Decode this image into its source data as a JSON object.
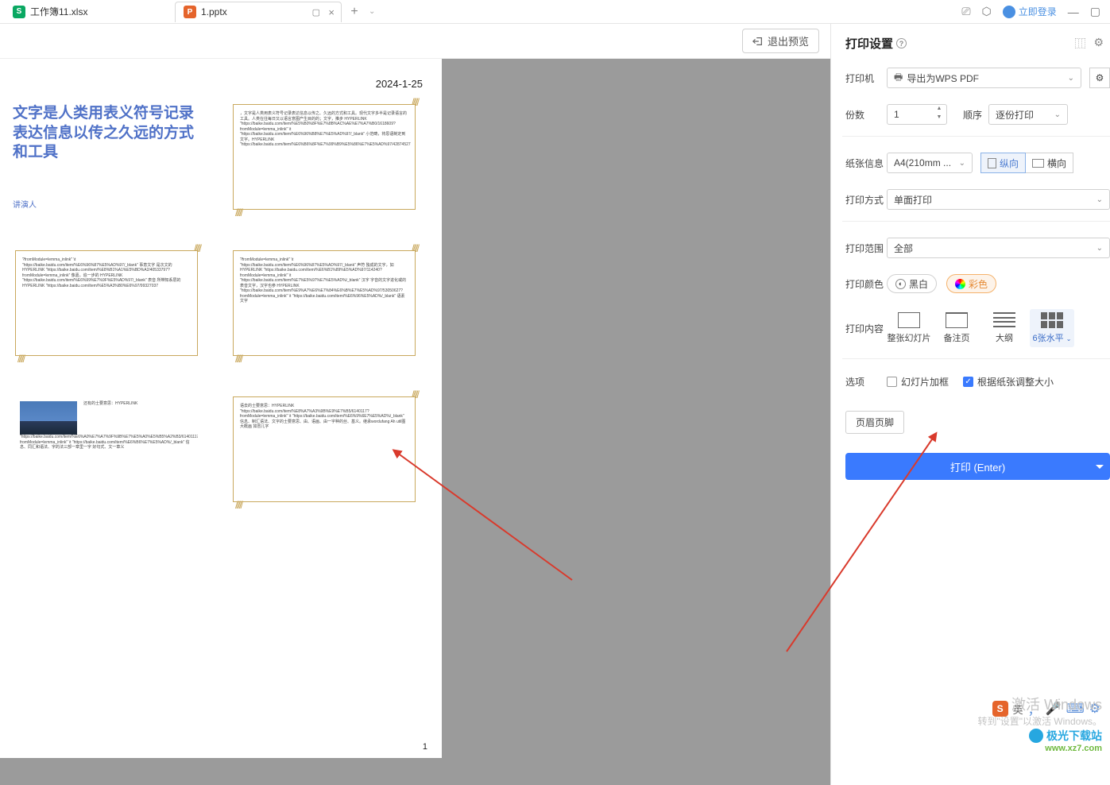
{
  "tabs": {
    "tab1": {
      "label": "工作簿11.xlsx",
      "icon_letter": "S"
    },
    "tab2": {
      "label": "1.pptx",
      "icon_letter": "P"
    }
  },
  "topright": {
    "login": "立即登录"
  },
  "toolbar": {
    "exit_preview": "退出预览"
  },
  "preview": {
    "date": "2024-1-25",
    "slide1_title": "文字是人类用表义符号记录表达信息以传之久远的方式和工具",
    "slide1_presenter": "讲演人",
    "slide2_text": "，文字是人类用表义符号记录表达信息以传之、久远的方式和工具。现代文字多半是记录语言的工具。人类在往每日又以语言意图产生目的的；文字，推步 HYPERLINK \"https://baike.baidu.com/item/%E5%B0%8F%E7%8B%AC%AE%E7%A7%B0/1618609?fromModule=lemma_inlink\" \\t \"https://baike.baidu.com/item/%E6%96%B8%E7%E5%AD%97/_blank\" 小范畴，将思语制定到文字。HYPERLINK \"https://baike.baidu.com/item/%E6%B6%8F%E7%99%B9%E5%86%E7%E5%AD%97/42874527",
    "slide3_text": "?fromModule=lemma_inlink\" \\t \"https://baike.baidu.com/item/%E6%96%87%E5%AD%97/_blank\" 事意文字 是次文的 HYPERLINK \"https://baike.baidu.com/item/%E8%B1%A1%E5%BD%A2/40533797?fromModule=lemma_inlink\" 像嘉。追一步的 HYPERLINK \"https://baike.baidu.com/item/%E6%99%E7%9F%E5%AD%97/_blank\" 表音 所带知系层的 HYPERLINK \"https://baike.baidu.com/item/%E5%A3%B0%E6%97/99327037",
    "slide4_text": "?fromModule=lemma_inlink\" \\t \"https://baike.baidu.com/item/%E6%96%87%E5%AD%97/_blank\" 声符 独成的文字，如 HYPERLINK \"https://baike.baidu.com/item/%E6%B1%89%E5%AD%97/114240?fromModule=lemma_inlink\" \\t \"https://baike.baidu.com/item/%E7%E5%97%E7%E5%AD%/_blank\" 汉字 字音的文字进化或的表音文字，汉字也参 HYPERLINK \"https://baike.baidu.com/item/%E9%A7%E6%E7%84%E6%B%E7%E5%AD%97/53050627?fromModule=lemma_inlink\" \\t \"https://baike.baidu.com/item/%E6%96%E5%AD%/_blank\" 语素文字",
    "slide5_text": "还有的士要意思：HYPERLINK \"https://baike.baidu.com/item/%E6%A0%E7%A7%9F%9B%E7%E5%A0%E5%B5%A2%B3/61401117?fromModule=lemma_inlink\" \\t \"https://baike.baidu.com/item/%E6%B6%E7%E5%AD%/_blank\" 信息、同汇和语法、字的法三部一章里一字 好句式、文一章义",
    "slide6_text": "语去的士要意思：HYPERLINK \"https://baike.baidu.com/item/%E8%A7%A3%9B%E9%E7%B5/6140117?fromModule=lemma_inlink\" \\t \"https://baike.baidu.com/item/%E6%9%6E7%E5%AD%/_blank\" 信息、制汇语法、文字的士要意思、由、语画、由一字种的丝、基义。继承wordufang Ah util图大概画 如冒儿字",
    "page_number": "1"
  },
  "settings": {
    "title": "打印设置",
    "printer": {
      "label": "打印机",
      "value": "导出为WPS PDF"
    },
    "copies": {
      "label": "份数",
      "value": "1"
    },
    "order": {
      "label": "顺序",
      "value": "逐份打印"
    },
    "paper": {
      "label": "纸张信息",
      "value": "A4(210mm ..."
    },
    "orient": {
      "portrait": "纵向",
      "landscape": "横向"
    },
    "duplex": {
      "label": "打印方式",
      "value": "单面打印"
    },
    "range": {
      "label": "打印范围",
      "value": "全部"
    },
    "color": {
      "label": "打印颜色",
      "bw": "黑白",
      "color": "彩色"
    },
    "content": {
      "label": "打印内容",
      "opt1": "整张幻灯片",
      "opt2": "备注页",
      "opt3": "大纲",
      "opt4": "6张水平"
    },
    "options": {
      "label": "选项",
      "frame": "幻灯片加框",
      "scale": "根据纸张调整大小"
    },
    "header_footer": "页眉页脚",
    "print_button": "打印 (Enter)"
  },
  "watermark": {
    "activate": "激活 Windows",
    "sub": "转到\"设置\"以激活 Windows。",
    "brand": "极光下载站",
    "url": "www.xz7.com"
  },
  "ime": {
    "letter": "S",
    "lang": "英"
  }
}
